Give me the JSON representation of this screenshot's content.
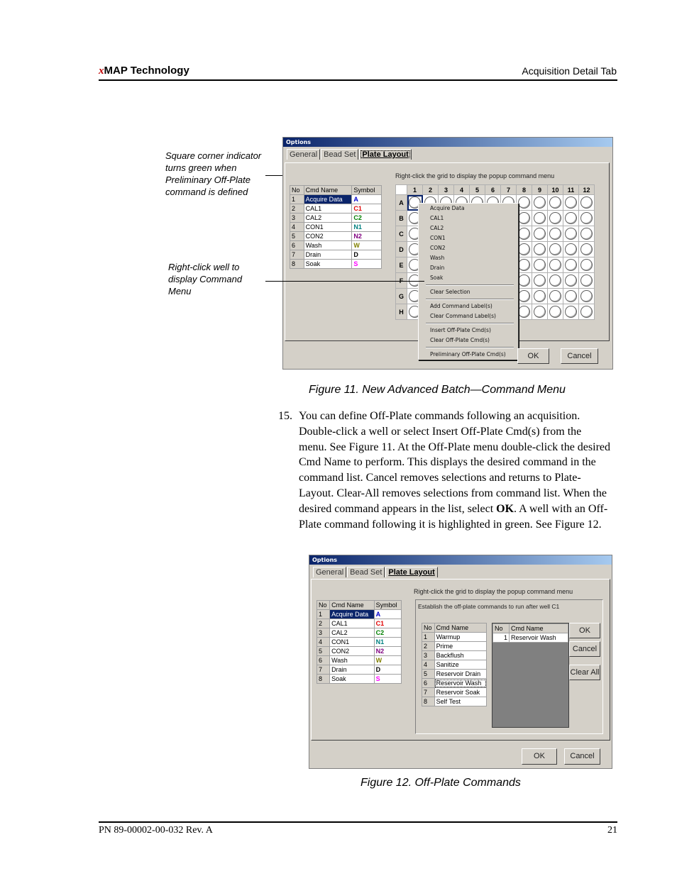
{
  "header": {
    "brand_prefix": "x",
    "brand_rest": "MAP  Technology",
    "section": "Acquisition Detail Tab"
  },
  "footer": {
    "part_number": "PN 89-00002-00-032 Rev. A",
    "page_number": "21"
  },
  "callouts": {
    "corner_indicator": "Square corner indicator turns green when Preliminary Off-Plate command is defined",
    "right_click": "Right-click well to display Command Menu"
  },
  "figure11": {
    "title": "Options",
    "tabs": [
      "General",
      "Bead Set",
      "Plate Layout"
    ],
    "active_tab": "Plate Layout",
    "hint": "Right-click the grid to display the popup command menu",
    "cmd_table": {
      "headers": [
        "No",
        "Cmd Name",
        "Symbol"
      ],
      "rows": [
        {
          "no": "1",
          "name": "Acquire Data",
          "symbol": "A",
          "color": "#0000cc",
          "selected": true
        },
        {
          "no": "2",
          "name": "CAL1",
          "symbol": "C1",
          "color": "#e00000"
        },
        {
          "no": "3",
          "name": "CAL2",
          "symbol": "C2",
          "color": "#008000"
        },
        {
          "no": "4",
          "name": "CON1",
          "symbol": "N1",
          "color": "#008080"
        },
        {
          "no": "5",
          "name": "CON2",
          "symbol": "N2",
          "color": "#800080"
        },
        {
          "no": "6",
          "name": "Wash",
          "symbol": "W",
          "color": "#808000"
        },
        {
          "no": "7",
          "name": "Drain",
          "symbol": "D",
          "color": "#000000"
        },
        {
          "no": "8",
          "name": "Soak",
          "symbol": "S",
          "color": "#ff00ff"
        }
      ]
    },
    "plate": {
      "columns": [
        "1",
        "2",
        "3",
        "4",
        "5",
        "6",
        "7",
        "8",
        "9",
        "10",
        "11",
        "12"
      ],
      "rows": [
        "A",
        "B",
        "C",
        "D",
        "E",
        "F",
        "G",
        "H"
      ],
      "selected_well": "A1"
    },
    "context_menu": {
      "groups": [
        [
          "Acquire Data",
          "CAL1",
          "CAL2",
          "CON1",
          "CON2",
          "Wash",
          "Drain",
          "Soak"
        ],
        [
          "Clear Selection"
        ],
        [
          "Add Command Label(s)",
          "Clear Command Label(s)"
        ],
        [
          "Insert Off-Plate Cmd(s)",
          "Clear Off-Plate Cmd(s)"
        ],
        [
          "Preliminary Off-Plate Cmd(s)"
        ]
      ]
    },
    "ok_label": "OK",
    "cancel_label": "Cancel",
    "caption": "Figure 11.  New Advanced Batch—Command Menu"
  },
  "step15": {
    "number": "15.",
    "text_before_bold": "You can define Off-Plate commands following an acquisition. Double-click a well or select Insert Off-Plate Cmd(s) from the menu. See Figure 11. At the Off-Plate menu double-click the desired Cmd Name to perform. This displays the desired command in the command list. Cancel removes selections and returns to Plate-Layout. Clear-All removes selections from command list. When the desired command appears in the list, select ",
    "bold": "OK",
    "text_after_bold": ". A well with an Off-Plate command following it is highlighted in green. See Figure 12."
  },
  "figure12": {
    "title": "Options",
    "tabs": [
      "General",
      "Bead Set",
      "Plate Layout"
    ],
    "active_tab": "Plate Layout",
    "hint": "Right-click the grid to display the popup command menu",
    "group_label": "Establish the off-plate commands to run after well C1",
    "available_headers": [
      "No",
      "Cmd Name"
    ],
    "available": [
      {
        "no": "1",
        "name": "Warmup"
      },
      {
        "no": "2",
        "name": "Prime"
      },
      {
        "no": "3",
        "name": "Backflush"
      },
      {
        "no": "4",
        "name": "Sanitize"
      },
      {
        "no": "5",
        "name": "Reservoir Drain"
      },
      {
        "no": "6",
        "name": "Reservoir Wash",
        "focused": true
      },
      {
        "no": "7",
        "name": "Reservoir Soak"
      },
      {
        "no": "8",
        "name": "Self Test"
      }
    ],
    "chosen_headers": [
      "No",
      "Cmd Name"
    ],
    "chosen": [
      {
        "no": "1",
        "name": "Reservoir Wash"
      }
    ],
    "side_buttons": [
      "OK",
      "Cancel",
      "Clear All"
    ],
    "ok_label": "OK",
    "cancel_label": "Cancel",
    "caption": "Figure 12.  Off-Plate Commands"
  }
}
